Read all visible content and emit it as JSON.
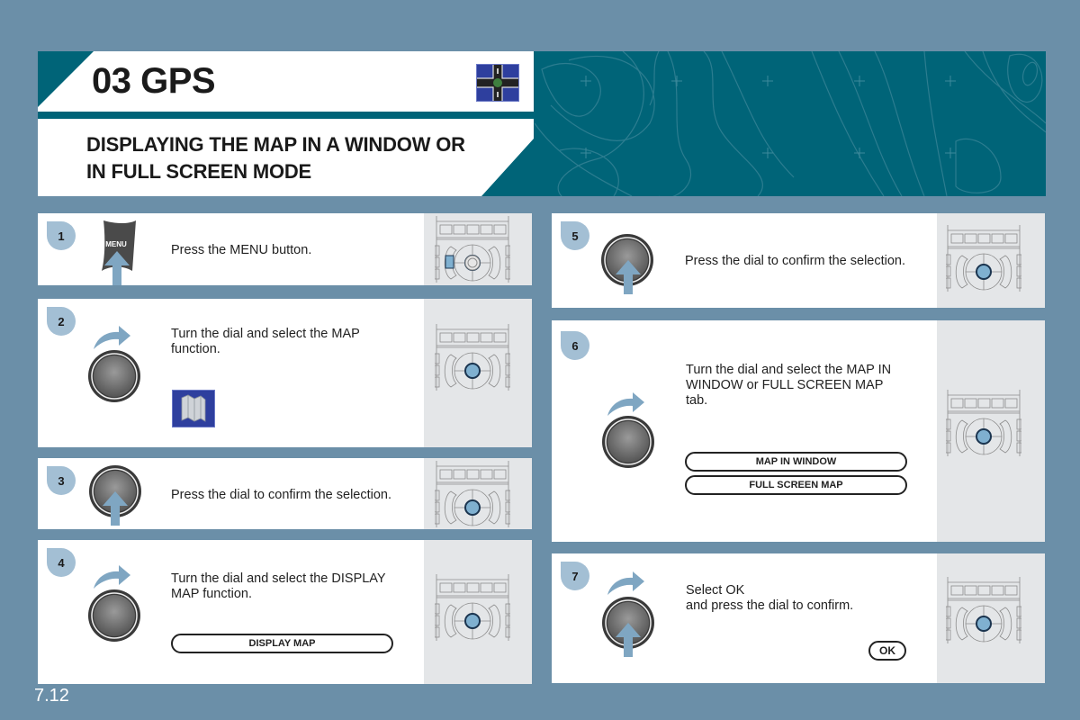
{
  "header": {
    "section_title": "03 GPS",
    "section_icon": "junction-icon",
    "page_title_line1": "DISPLAYING THE MAP IN A WINDOW OR",
    "page_title_line2": "IN FULL SCREEN MODE"
  },
  "colors": {
    "background": "#6b8fa8",
    "header_teal": "#006478",
    "badge": "#a3bfd4",
    "arrow": "#7fa6c2",
    "icon_blue": "#2e3f9e"
  },
  "steps": [
    {
      "number": "1",
      "text": "Press the MENU button.",
      "button_label": "MENU",
      "icon": "menu-button-icon",
      "action": "push"
    },
    {
      "number": "2",
      "text": "Turn the dial and select the MAP\nfunction.",
      "icon": "map-icon",
      "action": "turn"
    },
    {
      "number": "3",
      "text": "Press the dial to confirm the selection.",
      "action": "push"
    },
    {
      "number": "4",
      "text": "Turn the dial and select the DISPLAY\nMAP function.",
      "action": "turn",
      "options": [
        "DISPLAY MAP"
      ]
    },
    {
      "number": "5",
      "text": "Press the dial to confirm the selection.",
      "action": "push"
    },
    {
      "number": "6",
      "text": "Turn the dial and select the MAP IN\nWINDOW or FULL SCREEN MAP\ntab.",
      "action": "turn",
      "options": [
        "MAP IN WINDOW",
        "FULL SCREEN MAP"
      ]
    },
    {
      "number": "7",
      "text": "Select OK\nand press the dial to confirm.",
      "action": "turn-push",
      "options": [
        "OK"
      ]
    }
  ],
  "footer": {
    "page_number": "7.12"
  }
}
